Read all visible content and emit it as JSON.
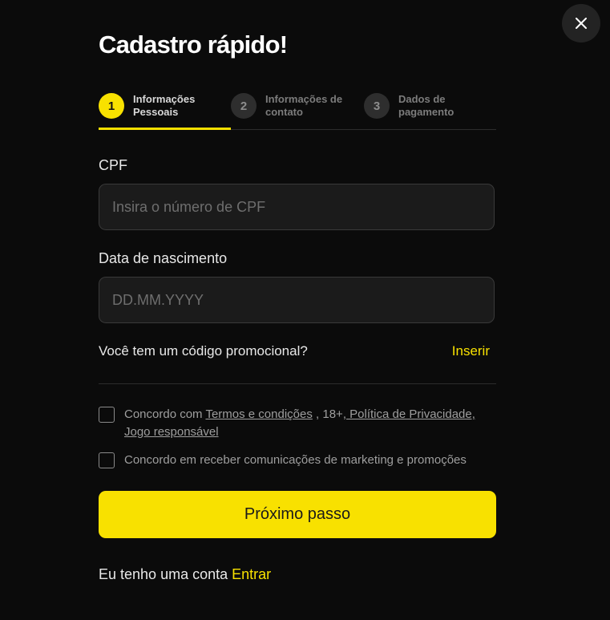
{
  "modal": {
    "title": "Cadastro rápido!",
    "close_icon": "close-icon"
  },
  "stepper": {
    "active_index": 0,
    "steps": [
      {
        "number": "1",
        "line1": "Informações",
        "line2": "Pessoais"
      },
      {
        "number": "2",
        "line1": "Informações de",
        "line2": "contato"
      },
      {
        "number": "3",
        "line1": "Dados de",
        "line2": "pagamento"
      }
    ]
  },
  "form": {
    "cpf": {
      "label": "CPF",
      "value": "",
      "placeholder": "Insira o número de CPF"
    },
    "birthdate": {
      "label": "Data de nascimento",
      "value": "",
      "placeholder": "DD.MM.YYYY"
    },
    "promo": {
      "question": "Você tem um código promocional?",
      "link": "Inserir"
    },
    "consent_terms": {
      "checked": false,
      "prefix": "Concordo com ",
      "terms_link": "Termos e condições",
      "middle": " , 18+",
      "privacy_link": ", Política de Privacidade,",
      "responsible_link": "Jogo responsável"
    },
    "consent_marketing": {
      "checked": false,
      "text": "Concordo em receber comunicações de marketing e promoções"
    },
    "submit_label": "Próximo passo"
  },
  "footer": {
    "text": "Eu tenho uma conta ",
    "link": "Entrar"
  },
  "colors": {
    "accent": "#f8e100",
    "background": "#0b0b0b",
    "input_background": "#1b1b1b"
  }
}
